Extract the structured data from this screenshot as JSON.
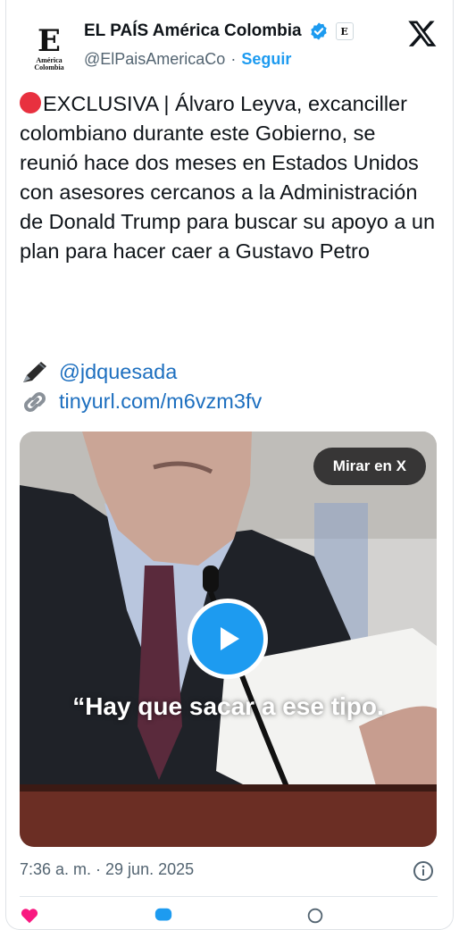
{
  "account": {
    "name": "EL PAÍS América Colombia",
    "handle": "@ElPaisAmericaCo",
    "separator": "·",
    "follow_label": "Seguir",
    "avatar_letter": "E",
    "avatar_subtitle_1": "América",
    "avatar_subtitle_2": "Colombia",
    "affiliate_letter": "E"
  },
  "tweet": {
    "text": "EXCLUSIVA | Álvaro Leyva, excanciller colombiano durante este Gobierno, se reunió hace dos meses en Estados Unidos con asesores cercanos a la Administración de Donald Trump para buscar su apoyo a un plan para hacer caer a Gustavo Petro",
    "author_mention": "@jdquesada",
    "link": "tinyurl.com/m6vzm3fv"
  },
  "media": {
    "watch_label": "Mirar en X",
    "caption": "“Hay que sacar a ese tipo."
  },
  "footer": {
    "timestamp": "7:36 a. m. · 29 jun. 2025"
  },
  "colors": {
    "accent": "#1d9bf0",
    "red_dot": "#e8303f"
  },
  "icons": [
    "verified-badge-icon",
    "x-logo-icon",
    "pen-icon",
    "link-icon",
    "play-icon",
    "info-icon",
    "like-icon",
    "reply-icon",
    "share-icon"
  ]
}
